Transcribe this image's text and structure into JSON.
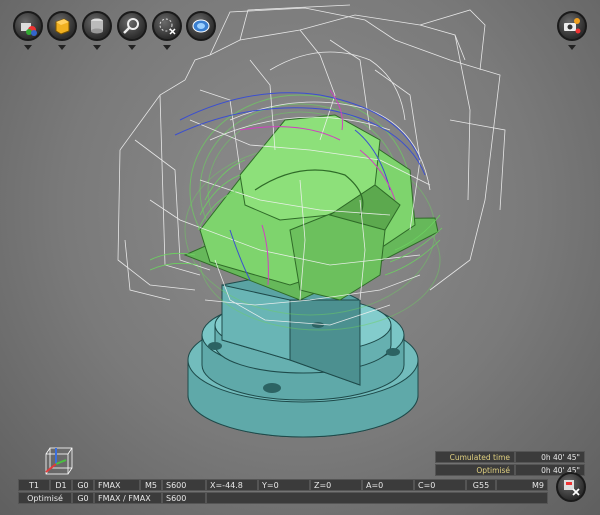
{
  "toolbar": {
    "buttons": [
      {
        "name": "view-machine-icon"
      },
      {
        "name": "view-stock-icon"
      },
      {
        "name": "view-part-icon"
      },
      {
        "name": "zoom-tools-icon"
      },
      {
        "name": "hide-toolpath-icon"
      },
      {
        "name": "view-orientation-icon"
      }
    ],
    "right_button": {
      "name": "camera-settings-icon"
    }
  },
  "status": {
    "row1": [
      "T1",
      "D1",
      "G0",
      "FMAX",
      "M5",
      "S600",
      "X=-44.8",
      "Y=0",
      "Z=0",
      "A=0",
      "C=0",
      "G55",
      "M9"
    ],
    "row2": [
      "Optimisé",
      "G0",
      "FMAX / FMAX",
      "S600"
    ]
  },
  "times": {
    "cumulated_label": "Cumulated time",
    "cumulated_value": "0h 40' 45\"",
    "optimised_label": "Optimisé",
    "optimised_value": "0h 40' 45\""
  },
  "colors": {
    "part": "#6cc860",
    "fixture": "#5fa9a9",
    "toolpath_white": "#f2f2f2",
    "toolpath_blue": "#3b4fd0",
    "toolpath_magenta": "#d040c0",
    "toolpath_green": "#6cd060",
    "background": "#7a7a7a"
  }
}
